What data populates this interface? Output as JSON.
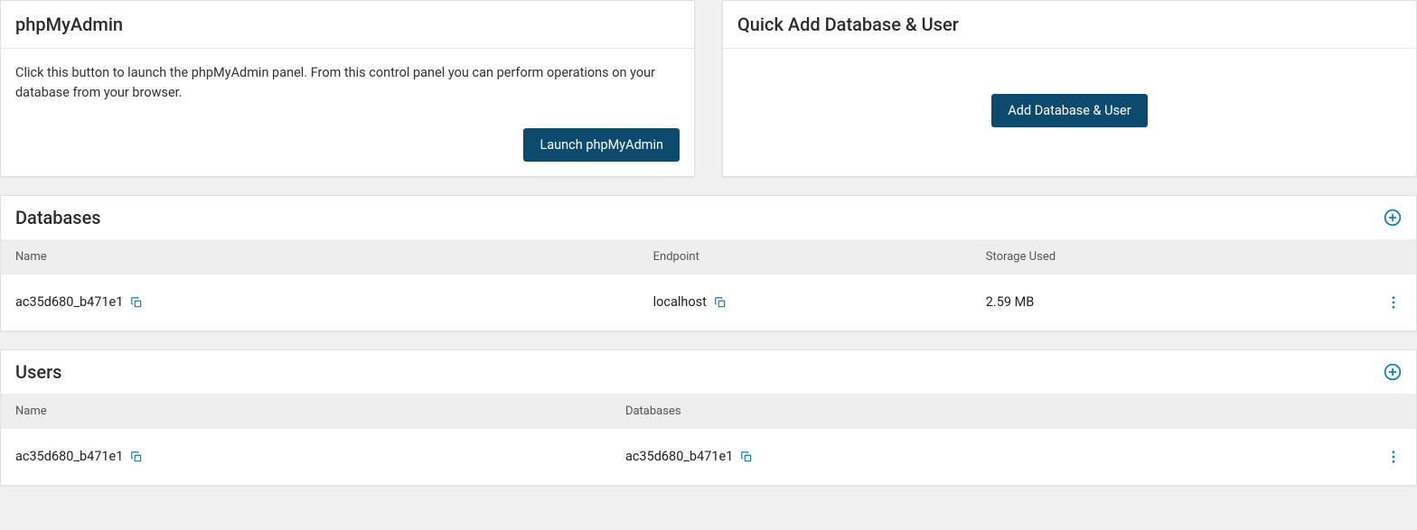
{
  "phpmyadmin": {
    "title": "phpMyAdmin",
    "description": "Click this button to launch the phpMyAdmin panel. From this control panel you can perform operations on your database from your browser.",
    "button_label": "Launch phpMyAdmin"
  },
  "quickadd": {
    "title": "Quick Add Database & User",
    "button_label": "Add Database & User"
  },
  "databases": {
    "title": "Databases",
    "columns": {
      "name": "Name",
      "endpoint": "Endpoint",
      "storage": "Storage Used"
    },
    "rows": [
      {
        "name": "ac35d680_b471e1",
        "endpoint": "localhost",
        "storage": "2.59 MB"
      }
    ]
  },
  "users": {
    "title": "Users",
    "columns": {
      "name": "Name",
      "databases": "Databases"
    },
    "rows": [
      {
        "name": "ac35d680_b471e1",
        "databases": "ac35d680_b471e1"
      }
    ]
  }
}
